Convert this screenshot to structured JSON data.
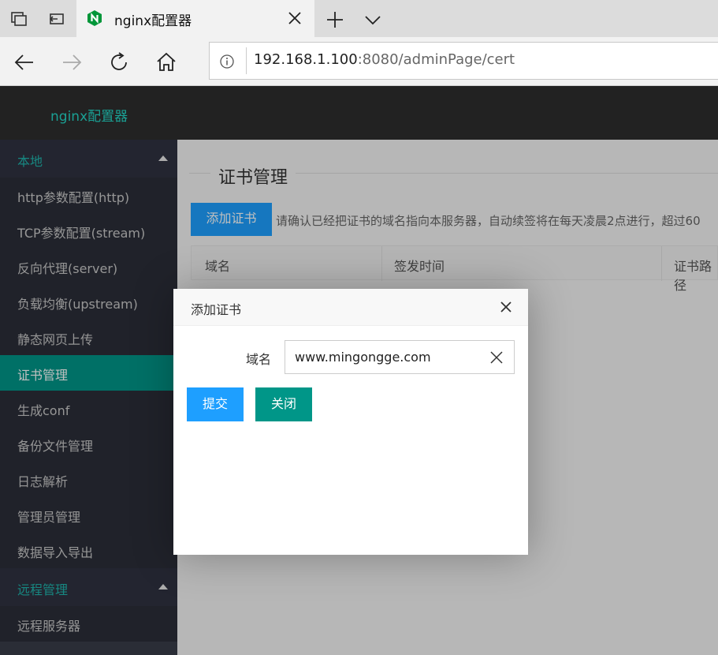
{
  "browser": {
    "tab_title": "nginx配置器",
    "url_host": "192.168.1.100",
    "url_rest": ":8080/adminPage/cert"
  },
  "app": {
    "logo": "nginx配置器"
  },
  "sidebar": {
    "group_local": "本地",
    "items": [
      {
        "label": "http参数配置(http)"
      },
      {
        "label": "TCP参数配置(stream)"
      },
      {
        "label": "反向代理(server)"
      },
      {
        "label": "负载均衡(upstream)"
      },
      {
        "label": "静态网页上传"
      },
      {
        "label": "证书管理"
      },
      {
        "label": "生成conf"
      },
      {
        "label": "备份文件管理"
      },
      {
        "label": "日志解析"
      },
      {
        "label": "管理员管理"
      },
      {
        "label": "数据导入导出"
      }
    ],
    "group_remote": "远程管理",
    "remote_items": [
      {
        "label": "远程服务器"
      }
    ]
  },
  "main": {
    "title": "证书管理",
    "add_button": "添加证书",
    "hint": "请确认已经把证书的域名指向本服务器，自动续签将在每天凌晨2点进行，超过60",
    "columns": [
      "域名",
      "签发时间",
      "证书路径"
    ]
  },
  "modal": {
    "title": "添加证书",
    "field_label": "域名",
    "field_value": "www.mingongge.com",
    "submit": "提交",
    "close": "关闭"
  },
  "colors": {
    "accent_teal": "#009688",
    "button_blue": "#1e9fff",
    "sidebar_bg": "#393d49",
    "header_bg": "#222222"
  }
}
